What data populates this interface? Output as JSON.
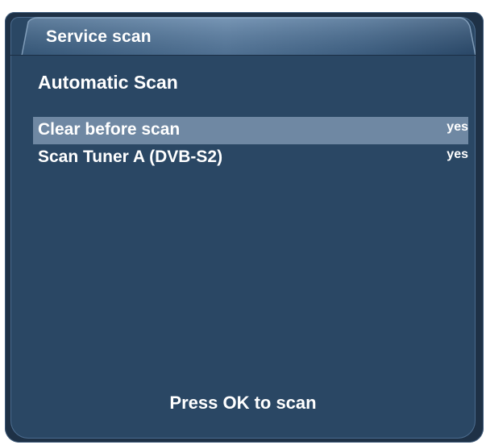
{
  "window": {
    "title": "Service scan",
    "heading": "Automatic Scan",
    "hint": "Press OK to scan"
  },
  "settings": {
    "items": [
      {
        "label": "Clear before scan",
        "value": "yes",
        "selected": true
      },
      {
        "label": "Scan Tuner A (DVB-S2)",
        "value": "yes",
        "selected": false
      }
    ]
  },
  "colors": {
    "background": "#2a4764",
    "frame": "#1e3146",
    "titlebar_start": "#4a6f95",
    "titlebar_end": "#2f5275",
    "selection": "#6f88a3",
    "text": "#ffffff"
  }
}
